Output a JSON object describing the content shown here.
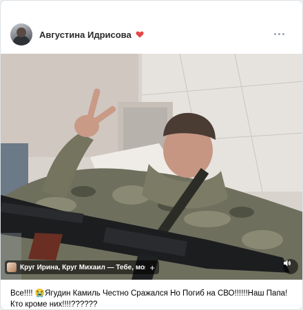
{
  "post": {
    "author": "Августина Идрисова",
    "author_badge_icon": "heart-icon",
    "more_icon": "more-dots-icon",
    "media": {
      "tagged_people": "Круг Ирина, Круг Михаил — Тебе, моя по",
      "tag_add_symbol": "+",
      "sound_icon": "speaker-icon"
    },
    "caption_line1": "Все!!!! 😭Ягудин Камиль Честно Сражался Но Погиб на СВО!!!!!!Наш Папа!",
    "caption_line2": "Кто кроме них!!!!??????"
  },
  "colors": {
    "card_bg": "#ffffff",
    "page_bg": "#edeef0",
    "heart": "#e64646",
    "muted_icon": "#99a2ad"
  }
}
